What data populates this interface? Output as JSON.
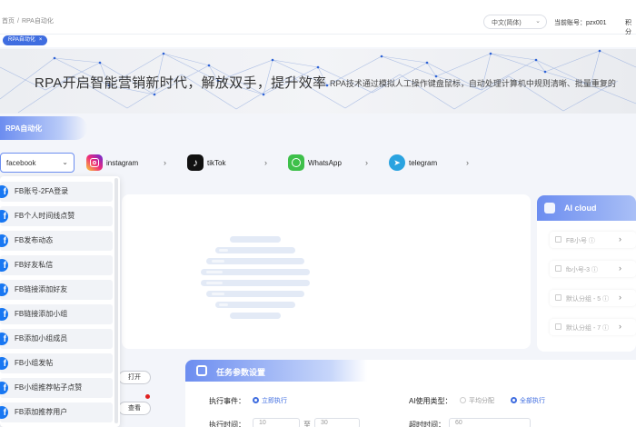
{
  "breadcrumb": [
    "首页",
    "/",
    "RPA自动化"
  ],
  "language": "中文(简体)",
  "account": "当前账号：pzx001",
  "points_label": "积分",
  "tab": {
    "label": "RPA自动化",
    "close": "×"
  },
  "banner": {
    "title": "RPA开启智能营销新时代，解放双手，提升效率",
    "subtitle": "RPA技术通过模拟人工操作键盘鼠标，自动处理计算机中规则清晰、批量重复的"
  },
  "section_title": "RPA自动化",
  "platform_select": {
    "value": "facebook"
  },
  "platforms": [
    {
      "name": "instagram",
      "icon": "instagram-icon"
    },
    {
      "name": "tikTok",
      "icon": "tiktok-icon"
    },
    {
      "name": "WhatsApp",
      "icon": "whatsapp-icon"
    },
    {
      "name": "telegram",
      "icon": "telegram-icon"
    }
  ],
  "fb_actions": [
    "FB账号-2FA登录",
    "FB个人时间线点赞",
    "FB发布动态",
    "FB好友私信",
    "FB链接添加好友",
    "FB链接添加小组",
    "FB添加小组成员",
    "FB小组发帖",
    "FB小组推荐帖子点赞",
    "FB添加推荐用户"
  ],
  "ai_cloud": {
    "title": "AI cloud",
    "items": [
      "FB小号",
      "fb小号-3",
      "默认分组 - 5",
      "默认分组 - 7"
    ]
  },
  "buttons": {
    "open": "打开",
    "view": "查看"
  },
  "task": {
    "title": "任务参数设置",
    "exec_event_label": "执行事件：",
    "exec_event_options": [
      {
        "label": "立即执行",
        "selected": true
      }
    ],
    "ai_type_label": "AI使用类型：",
    "ai_type_options": [
      {
        "label": "平均分配",
        "selected": false
      },
      {
        "label": "全部执行",
        "selected": true
      }
    ],
    "exec_time_label": "执行时间：",
    "time_from": "10",
    "time_to_sep": "至",
    "time_to": "30",
    "timeout_label": "超时时间：",
    "timeout_value": "60"
  },
  "colors": {
    "accent": "#3f6de0",
    "facebook": "#1877f2"
  }
}
